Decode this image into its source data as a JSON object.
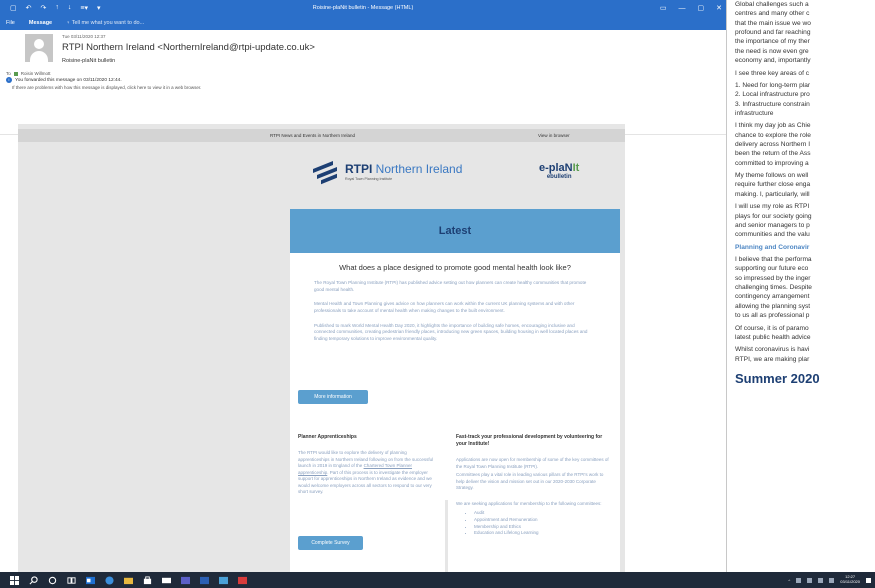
{
  "window": {
    "title": "Roisine-plaNit bulletin - Message (HTML)",
    "quick_access": [
      "▢",
      "↶",
      "↷",
      "↑",
      "↓",
      "≡▾",
      "▾"
    ],
    "controls": [
      "▭",
      "—",
      "▢",
      "✕"
    ]
  },
  "ribbon": {
    "tabs": [
      "File",
      "Message"
    ],
    "tell_me": "Tell me what you want to do..."
  },
  "email": {
    "date": "Tue 03/11/2020 12:37",
    "from": "RTPI Northern Ireland <NorthernIreland@rtpi-update.co.uk>",
    "subject": "Roisine-plaNit bulletin",
    "to_label": "To",
    "recipient": "Roisin Willmott",
    "forwarded": "You forwarded this message on 03/11/2020 12:44.",
    "display_problem": "If there are problems with how this message is displayed, click here to view it in a web browser."
  },
  "bulletin": {
    "news_events": "RTPI News and Events in Northern Ireland",
    "view_in_browser": "View in browser",
    "rtpi_logo": {
      "bold": "RTPI",
      "rest": " Northern Ireland",
      "sub": "Royal Town Planning Institute"
    },
    "eplanit": {
      "e": "e-plaN",
      "it": "It",
      "sub": "ebulletin"
    },
    "latest": "Latest",
    "headline": "What does a place designed to promote good mental health look like?",
    "paragraphs": [
      "The Royal Town Planning Institute (RTPI) has published advice setting out how planners can create healthy communities that promote good mental health.",
      "Mental Health and Town Planning gives advice on how planners can work within the current UK planning systems and with other professionals to take account of mental health when making changes to the built environment.",
      "Published to mark World Mental Health Day 2020, it highlights the importance of building safe homes, encouraging inclusive and connected communities, creating pedestrian friendly places, introducing new green spaces, building housing in well located places and finding temporary solutions to improve environmental quality."
    ],
    "more_info": "More information",
    "apprenticeships": {
      "title": "Planner Apprenticeships",
      "text_before": "The RTPI would like to explore the delivery of planning apprenticeships in Northern Ireland following on from the successful launch in 2019 in England of the ",
      "link": "Chartered Town Planner apprenticeship",
      "text_after": ". Part of this process is to investigate the employer support for apprenticeships in Northern Ireland as evidence and we would welcome employers across all sectors to respond to our very short survey.",
      "button": "Complete Survey"
    },
    "volunteer": {
      "title": "Fast-track your professional development by volunteering for your Institute!",
      "p1": "Applications are now open for membership of some of the key committees of the Royal Town Planning Institute (RTPI).",
      "p2": "Committees play a vital role in leading various pillars of the RTPI's work to help deliver the vision and mission set out in our 2020-2030 Corporate Strategy.",
      "p3": "We are seeking applications for membership to the following committees:",
      "items": [
        "Audit",
        "Appointment and Remuneration",
        "Membership and Ethics",
        "Education and Lifelong Learning"
      ]
    }
  },
  "article": {
    "lines1": [
      "Global challenges such a",
      "centres and many other c",
      "that the main issue we wo",
      "profound and far reaching",
      "the importance of my ther",
      "the need is now even gre",
      "economy and, importantly"
    ],
    "see3": "I see three key areas of c",
    "list": [
      "1. Need for long-term plar",
      "2. Local infrastructure pro",
      "3. Infrastructure constrain",
      "infrastructure"
    ],
    "lines2": [
      "I think my day job as Chie",
      "chance to explore the role",
      "delivery across Northern I",
      "been the return of the Ass",
      "committed to improving a"
    ],
    "lines3": [
      "My theme follows on well",
      "require further close enga",
      "making. I, particularly, will"
    ],
    "lines4": [
      "I will use my role as RTPI",
      "plays for our society going",
      "and senior managers to p",
      "communities and the valu"
    ],
    "heading": "Planning and Coronavir",
    "lines5": [
      "I believe that the performa",
      "supporting our future eco",
      "so impressed by the inger",
      "challenging times. Despite",
      "contingency arrangement",
      "allowing the planning syst",
      "to us all as professional p"
    ],
    "lines6": [
      "Of course, it is of paramo",
      "latest public health advice"
    ],
    "lines7": [
      "Whilst coronavirus is havi",
      "RTPI, we are making plar"
    ],
    "summer": "Summer 2020"
  },
  "taskbar": {
    "time": "12:27",
    "date": "03/11/2020"
  }
}
